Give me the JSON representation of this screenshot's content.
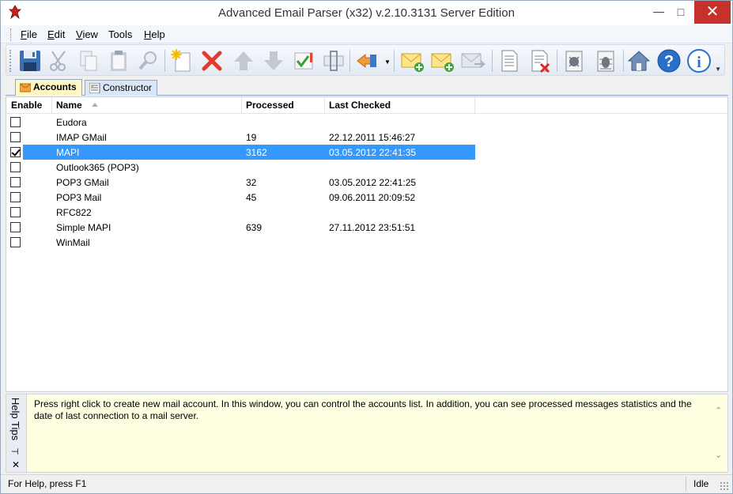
{
  "window": {
    "title": "Advanced Email Parser (x32) v.2.10.3131 Server Edition"
  },
  "menu": [
    {
      "label": "File",
      "key": "F",
      "rest": "ile"
    },
    {
      "label": "Edit",
      "key": "E",
      "rest": "dit"
    },
    {
      "label": "View",
      "key": "V",
      "rest": "iew"
    },
    {
      "label": "Tools",
      "key": "",
      "rest": "Tools"
    },
    {
      "label": "Help",
      "key": "H",
      "rest": "elp"
    }
  ],
  "toolbar": {
    "buttons": [
      "save-icon",
      "cut-icon",
      "copy-icon",
      "paste-icon",
      "find-icon",
      "new-icon",
      "delete-icon",
      "move-up-icon",
      "move-down-icon",
      "check-icon",
      "properties-icon",
      "import-icon",
      "mail-add-icon",
      "mail-add-alt-icon",
      "mail-send-icon",
      "document-icon",
      "document-delete-icon",
      "log-icon",
      "debug-icon",
      "home-icon",
      "help-icon",
      "info-icon"
    ]
  },
  "tabs": [
    {
      "label": "Accounts",
      "active": true
    },
    {
      "label": "Constructor",
      "active": false
    }
  ],
  "list": {
    "columns": [
      "Enable",
      "Name",
      "Processed",
      "Last Checked"
    ],
    "rows": [
      {
        "enabled": false,
        "name": "Eudora",
        "processed": "",
        "last_checked": ""
      },
      {
        "enabled": false,
        "name": "IMAP GMail",
        "processed": "19",
        "last_checked": "22.12.2011 15:46:27"
      },
      {
        "enabled": true,
        "name": "MAPI",
        "processed": "3162",
        "last_checked": "03.05.2012 22:41:35",
        "selected": true
      },
      {
        "enabled": false,
        "name": "Outlook365 (POP3)",
        "processed": "",
        "last_checked": ""
      },
      {
        "enabled": false,
        "name": "POP3 GMail",
        "processed": "32",
        "last_checked": "03.05.2012 22:41:25"
      },
      {
        "enabled": false,
        "name": "POP3 Mail",
        "processed": "45",
        "last_checked": "09.06.2011 20:09:52"
      },
      {
        "enabled": false,
        "name": "RFC822",
        "processed": "",
        "last_checked": ""
      },
      {
        "enabled": false,
        "name": "Simple MAPI",
        "processed": "639",
        "last_checked": "27.11.2012 23:51:51"
      },
      {
        "enabled": false,
        "name": "WinMail",
        "processed": "",
        "last_checked": ""
      }
    ]
  },
  "help_panel": {
    "label": "Help Tips",
    "text": "Press right click to create new mail account. In this window, you can control the accounts list. In addition, you can see processed messages statistics and the date of last connection to a mail server."
  },
  "status": {
    "left": "For Help, press F1",
    "right": "Idle"
  },
  "colors": {
    "selection": "#3399ff",
    "close": "#c7312b",
    "help_bg": "#ffffe1"
  }
}
